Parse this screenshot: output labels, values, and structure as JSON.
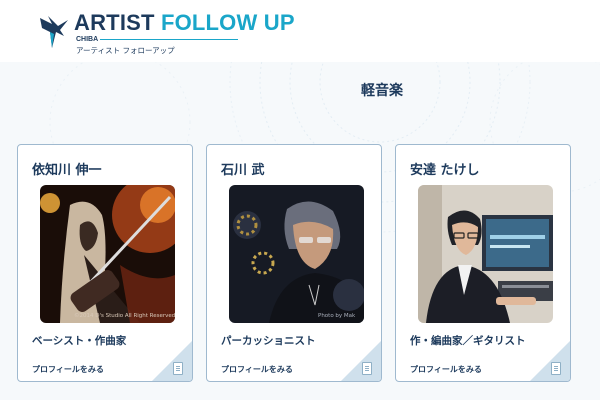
{
  "site": {
    "logo_main": "ARTIST ",
    "logo_accent": "FOLLOW UP",
    "logo_region": "CHIBA",
    "logo_ja": "アーティスト フォローアップ"
  },
  "section": {
    "category": "軽音楽"
  },
  "cards": [
    {
      "name": "依知川 伸一",
      "role": "ベーシスト・作曲家",
      "link": "プロフィールをみる",
      "photo_credit": "©2014 D's Studio All Right Reserved",
      "photo_subject": "guitarist-photo"
    },
    {
      "name": "石川 武",
      "role": "パーカッショニスト",
      "link": "プロフィールをみる",
      "photo_credit": "Photo by Mak",
      "photo_subject": "percussionist-photo"
    },
    {
      "name": "安達 たけし",
      "role": "作・編曲家／ギタリスト",
      "link": "プロフィールをみる",
      "photo_subject": "composer-studio-photo"
    }
  ],
  "colors": {
    "navy": "#1d3a5c",
    "accent": "#1aa6c9",
    "card_border": "#9fb9cf",
    "corner": "#cfe0ec"
  }
}
